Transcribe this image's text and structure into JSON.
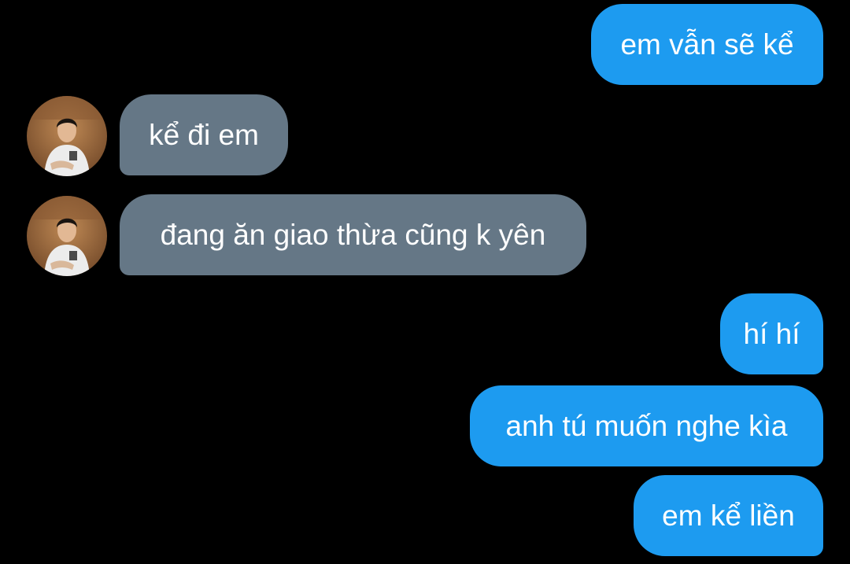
{
  "conversation": {
    "messages": [
      {
        "direction": "outgoing",
        "text": "em vẫn sẽ kể"
      },
      {
        "direction": "incoming",
        "text": "kể đi em",
        "has_avatar": true
      },
      {
        "direction": "incoming",
        "text": "đang ăn giao thừa cũng k yên",
        "has_avatar": true
      },
      {
        "direction": "outgoing",
        "text": "hí hí"
      },
      {
        "direction": "outgoing",
        "text": "anh tú muốn nghe kìa"
      },
      {
        "direction": "outgoing",
        "text": "em kể liền"
      }
    ]
  },
  "colors": {
    "background": "#000000",
    "outgoing_bubble": "#1d9bf0",
    "incoming_bubble": "#657786",
    "text": "#ffffff"
  }
}
